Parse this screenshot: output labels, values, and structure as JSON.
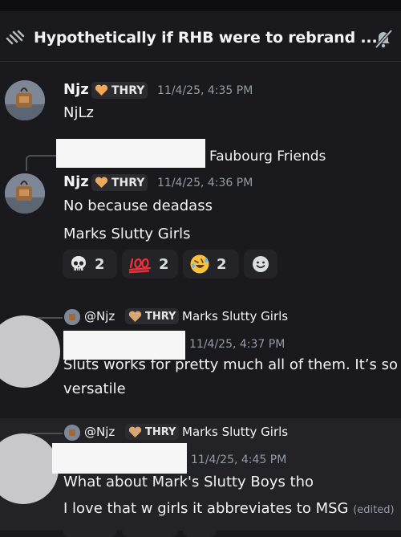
{
  "header": {
    "title": "Hypothetically if RHB were to rebrand ..."
  },
  "messages": [
    {
      "username": "Njz",
      "tag": "THRY",
      "time": "11/4/25, 4:35 PM",
      "lines": [
        "NjLz"
      ]
    },
    {
      "reply_to_text": "Faubourg Friends",
      "username": "Njz",
      "tag": "THRY",
      "time": "11/4/25, 4:36 PM",
      "lines": [
        "No because deadass",
        "Marks Slutty Girls"
      ],
      "reactions": [
        {
          "emoji": "skull-icon",
          "count": "2"
        },
        {
          "emoji": "hundred-icon",
          "count": "2"
        },
        {
          "emoji": "rofl-icon",
          "count": "2"
        },
        {
          "emoji": "add-reaction-icon",
          "count": ""
        }
      ]
    },
    {
      "reply_to": {
        "mention": "@Njz",
        "tag": "THRY",
        "text": "Marks Slutty Girls"
      },
      "time": "11/4/25, 4:37 PM",
      "lines": [
        "Sluts works for pretty much all of them. It’s so",
        "versatile"
      ]
    },
    {
      "reply_to": {
        "mention": "@Njz",
        "tag": "THRY",
        "text": "Marks Slutty Girls"
      },
      "time": "11/4/25, 4:45 PM",
      "lines": [
        "What about Mark's Slutty Boys tho",
        "I love that w girls it abbreviates to MSG"
      ],
      "edited": "(edited)"
    }
  ],
  "colors": {
    "background": "#1a1a1e",
    "highlight": "#222227",
    "tag_bg": "#2b2b30",
    "redaction": "#f6f6f6",
    "avatar_placeholder": "#c8c8cc"
  }
}
